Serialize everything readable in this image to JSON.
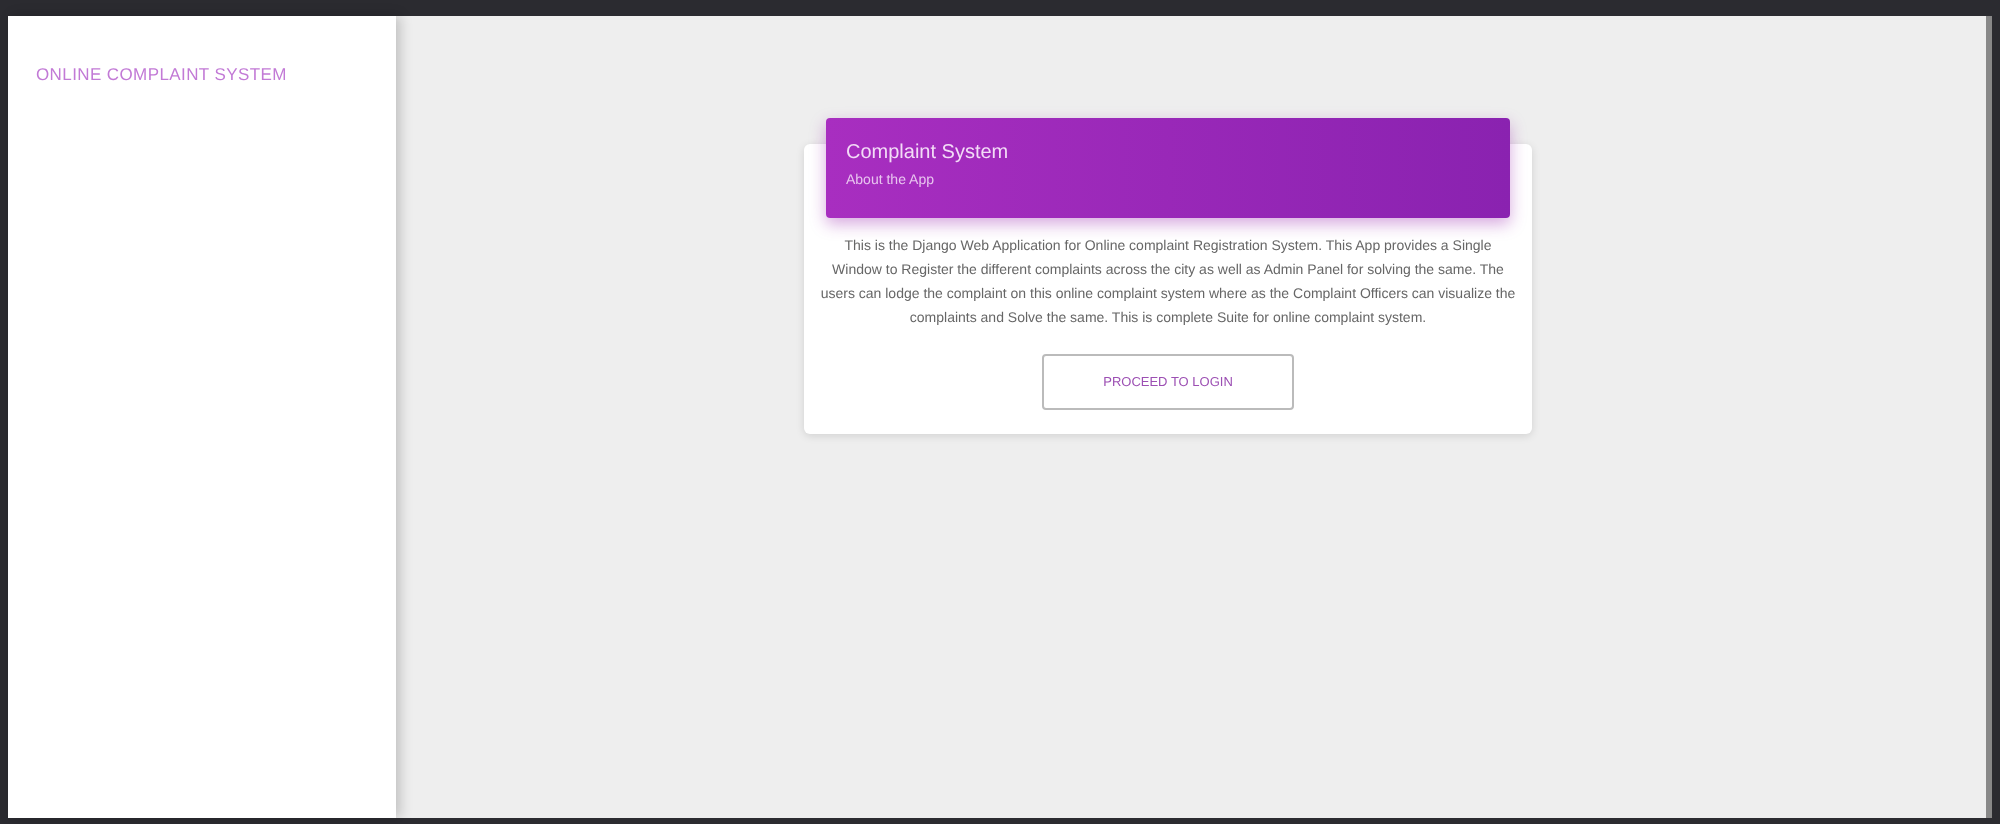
{
  "sidebar": {
    "brand": "ONLINE COMPLAINT SYSTEM"
  },
  "card": {
    "title": "Complaint System",
    "subtitle": "About the App",
    "description": "This is the Django Web Application for Online complaint Registration System. This App provides a Single Window to Register the different complaints across the city as well as Admin Panel for solving the same. The users can lodge the complaint on this online complaint system where as the Complaint Officers can visualize the complaints and Solve the same. This is complete Suite for online complaint system.",
    "button": "PROCEED TO LOGIN"
  }
}
